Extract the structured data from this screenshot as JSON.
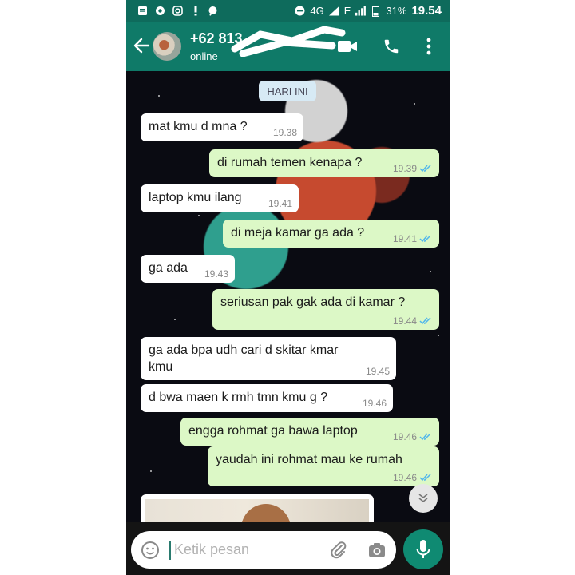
{
  "status_bar": {
    "network": "4G",
    "data_label": "E",
    "battery": "31%",
    "time": "19.54"
  },
  "header": {
    "contact_name": "+62 813",
    "status": "online"
  },
  "date_chip": "HARI INI",
  "messages": [
    {
      "dir": "in",
      "text": "mat kmu d mna ?",
      "time": "19.38"
    },
    {
      "dir": "out",
      "text": "di rumah temen kenapa ?",
      "time": "19.39"
    },
    {
      "dir": "in",
      "text": "laptop kmu ilang",
      "time": "19.41"
    },
    {
      "dir": "out",
      "text": "di meja kamar ga ada ?",
      "time": "19.41"
    },
    {
      "dir": "in",
      "text": "ga ada",
      "time": "19.43"
    },
    {
      "dir": "out",
      "text": "seriusan pak gak ada di kamar ?",
      "time": "19.44"
    },
    {
      "dir": "in",
      "text": "ga ada bpa udh cari d skitar kmar kmu",
      "time": "19.45"
    },
    {
      "dir": "in",
      "text": "d bwa maen k rmh tmn kmu g ?",
      "time": "19.46"
    },
    {
      "dir": "out",
      "text": "engga rohmat ga bawa laptop",
      "time": "19.46"
    },
    {
      "dir": "out",
      "text": "yaudah ini rohmat mau ke rumah",
      "time": "19.46"
    }
  ],
  "input": {
    "placeholder": "Ketik pesan"
  },
  "colors": {
    "header": "#0f7a68",
    "status_bar": "#0e6b5c",
    "outgoing_bubble": "#dcf8c6",
    "incoming_bubble": "#ffffff",
    "read_ticks": "#4fb6ec",
    "mic_button": "#0f8a72"
  },
  "icons": [
    "back-arrow-icon",
    "video-call-icon",
    "phone-icon",
    "more-vert-icon",
    "emoji-icon",
    "attach-icon",
    "camera-icon",
    "mic-icon",
    "double-check-icon",
    "chevron-down-icon"
  ]
}
